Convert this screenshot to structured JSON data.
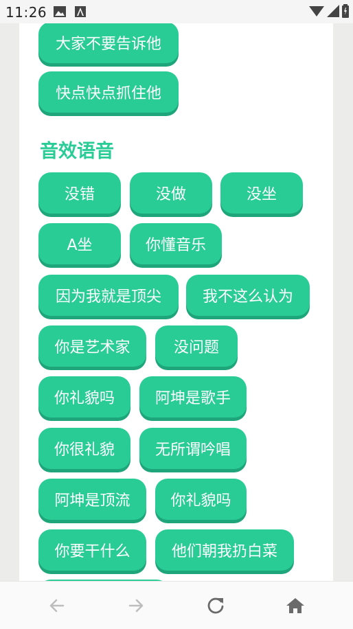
{
  "status": {
    "time": "11:26"
  },
  "top_buttons": [
    {
      "label": "大家不要告诉他"
    },
    {
      "label": "快点快点抓住他"
    }
  ],
  "section": {
    "title": "音效语音",
    "buttons": [
      {
        "label": "没错"
      },
      {
        "label": "没做"
      },
      {
        "label": "没坐"
      },
      {
        "label": "A坐"
      },
      {
        "label": "你懂音乐"
      },
      {
        "label": "因为我就是顶尖"
      },
      {
        "label": "我不这么认为"
      },
      {
        "label": "你是艺术家"
      },
      {
        "label": "没问题"
      },
      {
        "label": "你礼貌吗"
      },
      {
        "label": "阿坤是歌手"
      },
      {
        "label": "你很礼貌"
      },
      {
        "label": "无所谓吟唱"
      },
      {
        "label": "阿坤是顶流"
      },
      {
        "label": "你礼貌吗"
      },
      {
        "label": "你要干什么"
      },
      {
        "label": "他们朝我扔白菜"
      }
    ]
  },
  "colors": {
    "accent": "#29cc94",
    "accent_shadow": "#1ea579"
  },
  "nav": {
    "icons": [
      "back-icon",
      "forward-icon",
      "reload-icon",
      "home-icon"
    ]
  }
}
